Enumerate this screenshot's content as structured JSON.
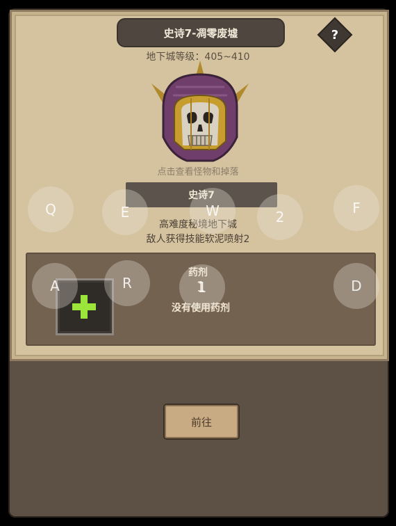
{
  "dungeon": {
    "title": "史诗7-凋零废墟",
    "level_text": "地下城等级：405~410",
    "help_label": "?",
    "monster_hint": "点击查看怪物和掉落"
  },
  "difficulty": {
    "name": "史诗7",
    "description_line1": "高难度秘境地下城",
    "description_line2": "敌人获得技能软泥喷射2"
  },
  "potion": {
    "title": "药剂",
    "count": "1",
    "status": "没有使用药剂"
  },
  "action": {
    "go_label": "前往"
  },
  "overlay_keys": [
    {
      "id": "q",
      "label": "Q"
    },
    {
      "id": "e",
      "label": "E"
    },
    {
      "id": "w",
      "label": "W"
    },
    {
      "id": "2",
      "label": "2"
    },
    {
      "id": "f",
      "label": "F"
    },
    {
      "id": "a",
      "label": "A"
    },
    {
      "id": "r",
      "label": "R"
    },
    {
      "id": "1",
      "label": "1"
    },
    {
      "id": "d",
      "label": "D"
    }
  ],
  "colors": {
    "accent_plus": "#9ce53a",
    "panel_bg": "#d5c3a0",
    "title_bg": "#4e463f"
  }
}
